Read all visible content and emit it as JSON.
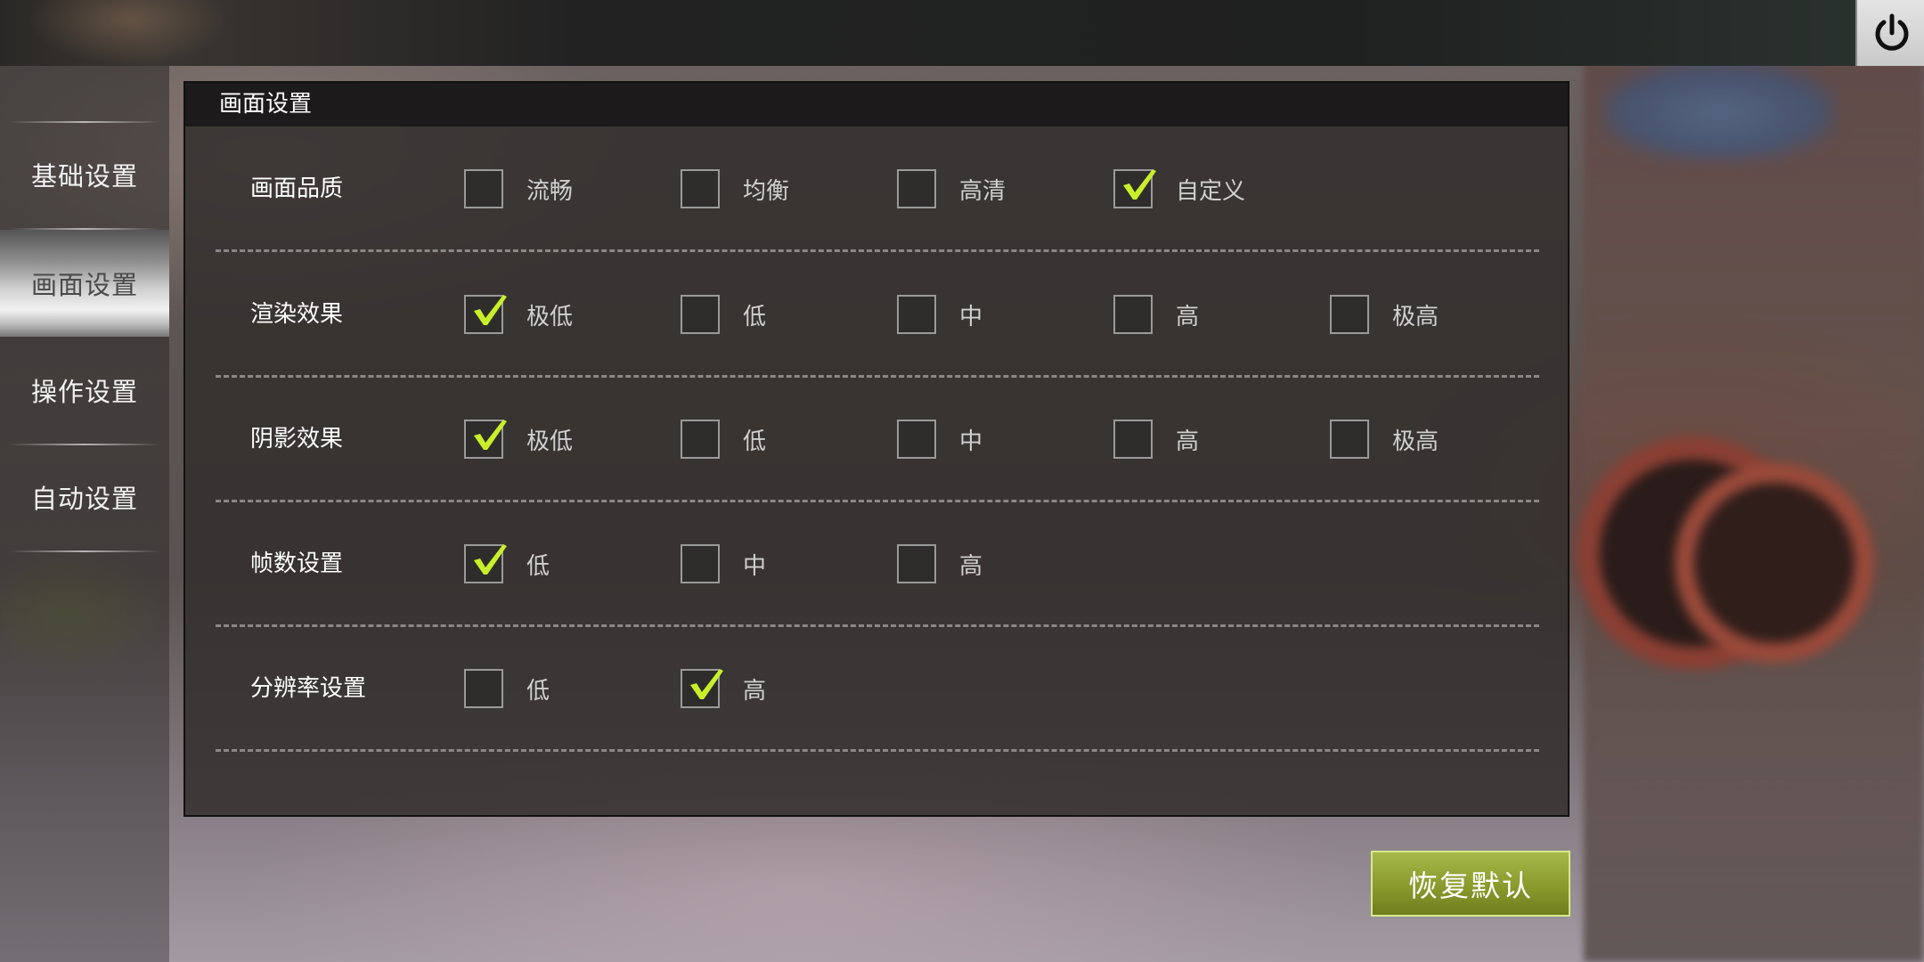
{
  "colors": {
    "accent": "#c8f02a",
    "button": "#8a9a2c"
  },
  "sidebar": {
    "items": [
      {
        "label": "基础设置",
        "active": false
      },
      {
        "label": "画面设置",
        "active": true
      },
      {
        "label": "操作设置",
        "active": false
      },
      {
        "label": "自动设置",
        "active": false
      }
    ]
  },
  "panel": {
    "title": "画面设置",
    "rows": [
      {
        "label": "画面品质",
        "options": [
          {
            "label": "流畅",
            "checked": false
          },
          {
            "label": "均衡",
            "checked": false
          },
          {
            "label": "高清",
            "checked": false
          },
          {
            "label": "自定义",
            "checked": true
          }
        ]
      },
      {
        "label": "渲染效果",
        "options": [
          {
            "label": "极低",
            "checked": true
          },
          {
            "label": "低",
            "checked": false
          },
          {
            "label": "中",
            "checked": false
          },
          {
            "label": "高",
            "checked": false
          },
          {
            "label": "极高",
            "checked": false
          }
        ]
      },
      {
        "label": "阴影效果",
        "options": [
          {
            "label": "极低",
            "checked": true
          },
          {
            "label": "低",
            "checked": false
          },
          {
            "label": "中",
            "checked": false
          },
          {
            "label": "高",
            "checked": false
          },
          {
            "label": "极高",
            "checked": false
          }
        ]
      },
      {
        "label": "帧数设置",
        "options": [
          {
            "label": "低",
            "checked": true
          },
          {
            "label": "中",
            "checked": false
          },
          {
            "label": "高",
            "checked": false
          }
        ]
      },
      {
        "label": "分辨率设置",
        "options": [
          {
            "label": "低",
            "checked": false
          },
          {
            "label": "高",
            "checked": true
          }
        ]
      }
    ]
  },
  "reset_button": {
    "label": "恢复默认"
  },
  "icons": {
    "power": "power-icon",
    "check": "check-icon"
  }
}
